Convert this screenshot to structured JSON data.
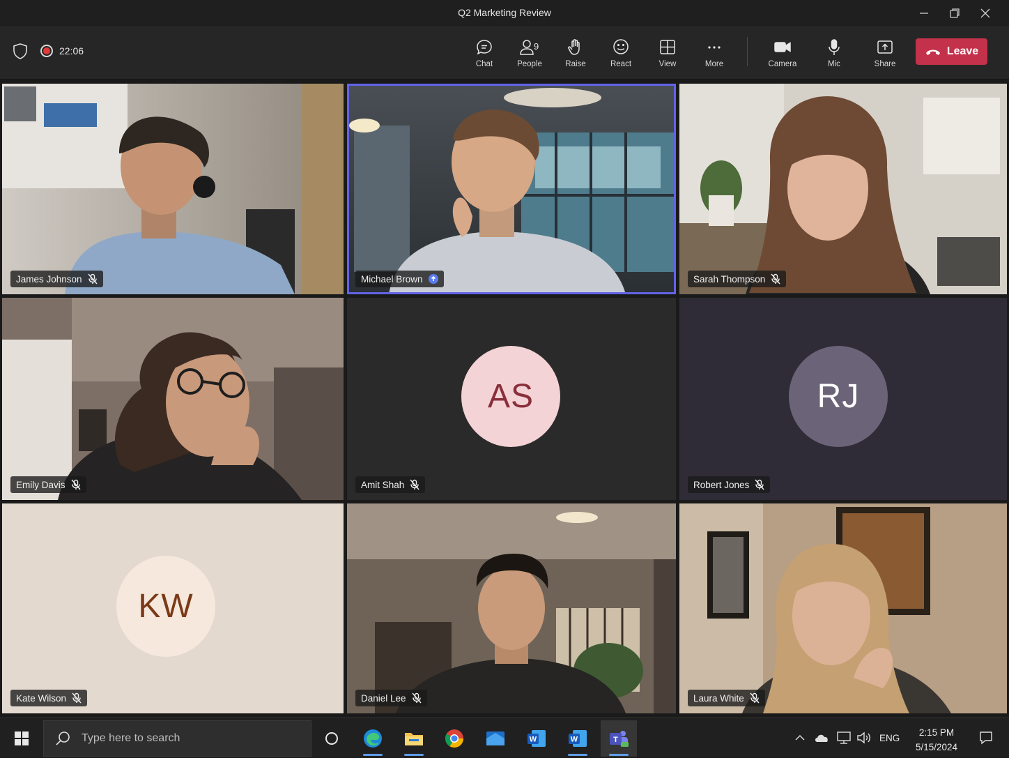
{
  "window": {
    "title": "Q2 Marketing Review"
  },
  "toolbar": {
    "timer": "22:06",
    "buttons": {
      "chat": "Chat",
      "people": "People",
      "people_count": "9",
      "raise": "Raise",
      "react": "React",
      "view": "View",
      "more": "More",
      "camera": "Camera",
      "mic": "Mic",
      "share": "Share"
    },
    "leave_label": "Leave"
  },
  "participants": [
    {
      "name": "James Johnson",
      "muted": true,
      "video": true
    },
    {
      "name": "Michael Brown",
      "muted": false,
      "video": true,
      "active_speaker": true
    },
    {
      "name": "Sarah Thompson",
      "muted": true,
      "video": true
    },
    {
      "name": "Emily Davis",
      "muted": true,
      "video": true
    },
    {
      "name": "Amit Shah",
      "muted": true,
      "video": false,
      "initials": "AS"
    },
    {
      "name": "Robert Jones",
      "muted": true,
      "video": false,
      "initials": "RJ"
    },
    {
      "name": "Kate Wilson",
      "muted": true,
      "video": false,
      "initials": "KW"
    },
    {
      "name": "Daniel Lee",
      "muted": true,
      "video": true
    },
    {
      "name": "Laura White",
      "muted": true,
      "video": true
    }
  ],
  "taskbar": {
    "search_placeholder": "Type here to search",
    "language": "ENG",
    "time": "2:15 PM",
    "date": "5/15/2024"
  },
  "colors": {
    "leave_button": "#c4314b",
    "active_speaker_outline": "#6264e8",
    "avatar_as_bg": "#f3d3d6",
    "avatar_as_fg": "#8a2f3a",
    "avatar_rj_bg": "#6b6478",
    "avatar_kw_bg": "#f6e8dc",
    "avatar_kw_fg": "#7a3a17"
  }
}
